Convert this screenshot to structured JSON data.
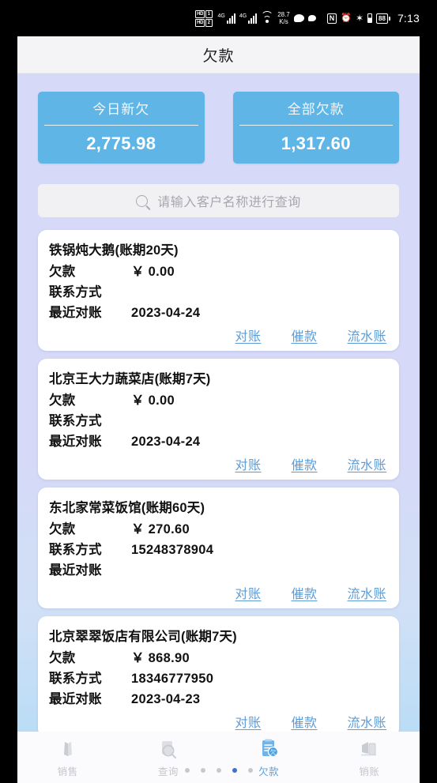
{
  "statusbar": {
    "hd_badge_1": "HD",
    "hd_num_1": "1",
    "hd_badge_2": "HD",
    "hd_num_2": "2",
    "signal_1_gen": "4G",
    "signal_2_gen": "4G",
    "network_speed": "28.7",
    "network_speed_unit": "K/s",
    "nfc": "N",
    "alarm_icon": "⏰",
    "bluetooth_icon": "✶",
    "battery_level": "88",
    "time": "7:13"
  },
  "header": {
    "title": "欠款"
  },
  "stats": [
    {
      "label": "今日新欠",
      "value": "2,775.98"
    },
    {
      "label": "全部欠款",
      "value": "1,317.60"
    }
  ],
  "search": {
    "placeholder": "请输入客户名称进行查询",
    "value": "",
    "icon": "search-icon"
  },
  "labels": {
    "debt": "欠款",
    "contact": "联系方式",
    "last_reconcile": "最近对账"
  },
  "actions": {
    "reconcile": "对账",
    "remind": "催款",
    "ledger": "流水账"
  },
  "customers": [
    {
      "name": "铁锅炖大鹅(账期20天)",
      "debt": "￥ 0.00",
      "contact": "",
      "last_reconcile": "2023-04-24"
    },
    {
      "name": "北京王大力蔬菜店(账期7天)",
      "debt": "￥ 0.00",
      "contact": "",
      "last_reconcile": "2023-04-24"
    },
    {
      "name": "东北家常菜饭馆(账期60天)",
      "debt": "￥ 270.60",
      "contact": "15248378904",
      "last_reconcile": ""
    },
    {
      "name": "北京翠翠饭店有限公司(账期7天)",
      "debt": "￥ 868.90",
      "contact": "18346777950",
      "last_reconcile": "2023-04-23"
    }
  ],
  "tabbar": {
    "items": [
      {
        "label": "销售",
        "icon": "sales-icon",
        "active": false
      },
      {
        "label": "查询",
        "icon": "query-search-icon",
        "active": false
      },
      {
        "label": "欠款",
        "icon": "debt-clipboard-icon",
        "active": true
      },
      {
        "label": "销账",
        "icon": "writeoff-icon",
        "active": false
      }
    ],
    "page_dots": {
      "count": 5,
      "active_index": 3
    }
  },
  "colors": {
    "accent_blue": "#5fb6e6",
    "link_blue": "#5b9cd8",
    "active_tab": "#56a2e0",
    "background": "#d6d9f7",
    "dot_active": "#3f6fd0"
  }
}
